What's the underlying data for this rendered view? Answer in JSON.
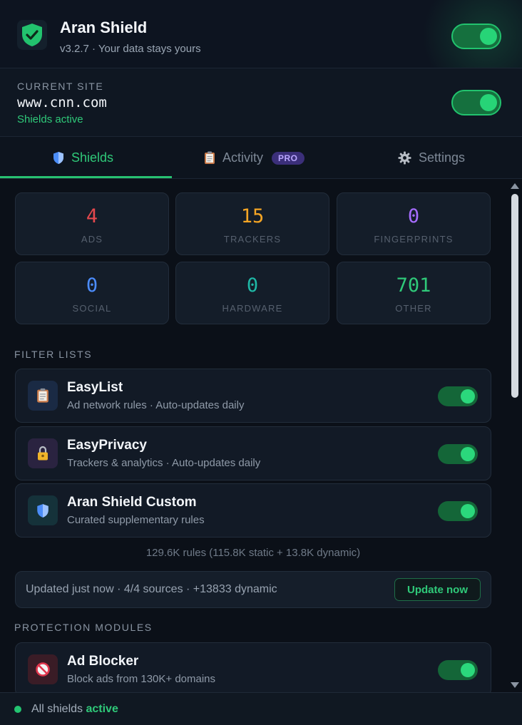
{
  "colors": {
    "accent": "#2fc979",
    "ads": "#e5484d",
    "trackers": "#f5a524",
    "fingerprints": "#a66cff",
    "social": "#4c8dff",
    "hardware": "#1fb8a6",
    "other": "#2fc979"
  },
  "header": {
    "title": "Aran Shield",
    "subtitle": "v3.2.7 · Your data stays yours",
    "icon": "shield-check-icon",
    "enabled": true
  },
  "site": {
    "label": "CURRENT SITE",
    "domain": "www.cnn.com",
    "status": "Shields active",
    "enabled": true
  },
  "tabs": [
    {
      "label": "Shields",
      "icon": "shield-icon",
      "active": true
    },
    {
      "label": "Activity",
      "icon": "clipboard-icon",
      "badge": "PRO"
    },
    {
      "label": "Settings",
      "icon": "gear-icon"
    }
  ],
  "stats": [
    {
      "value": "4",
      "label": "ADS"
    },
    {
      "value": "15",
      "label": "TRACKERS"
    },
    {
      "value": "0",
      "label": "FINGERPRINTS"
    },
    {
      "value": "0",
      "label": "SOCIAL"
    },
    {
      "value": "0",
      "label": "HARDWARE"
    },
    {
      "value": "701",
      "label": "OTHER"
    }
  ],
  "filter_lists": {
    "label": "FILTER LISTS",
    "items": [
      {
        "name": "EasyList",
        "desc": "Ad network rules · Auto-updates daily",
        "icon": "clipboard-icon",
        "enabled": true
      },
      {
        "name": "EasyPrivacy",
        "desc": "Trackers & analytics · Auto-updates daily",
        "icon": "lock-icon",
        "enabled": true
      },
      {
        "name": "Aran Shield Custom",
        "desc": "Curated supplementary rules",
        "icon": "shield-icon",
        "enabled": true
      }
    ],
    "rules_summary": "129.6K rules (115.8K static + 13.8K dynamic)"
  },
  "update": {
    "text": "Updated just now · 4/4 sources · +13833 dynamic",
    "button": "Update now"
  },
  "modules": {
    "label": "PROTECTION MODULES",
    "items": [
      {
        "name": "Ad Blocker",
        "desc": "Block ads from 130K+ domains",
        "icon": "no-entry-icon",
        "enabled": true
      }
    ]
  },
  "footer": {
    "prefix": "All shields",
    "state": "active"
  }
}
